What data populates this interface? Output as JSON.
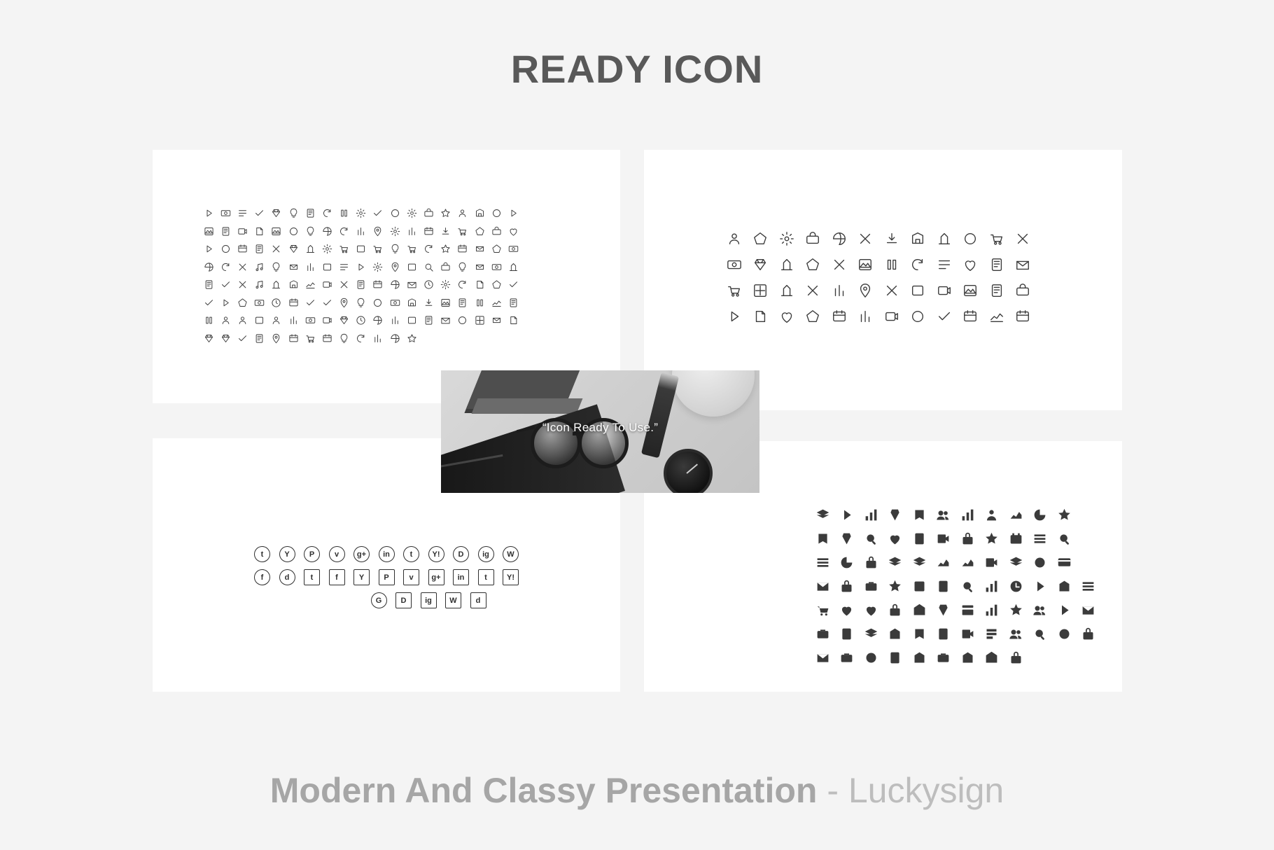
{
  "header": {
    "title": "READY ICON"
  },
  "footer": {
    "bold_text": "Modern And Classy Presentation",
    "light_text": " - Luckysign"
  },
  "photo": {
    "quote": "“Icon Ready To Use.”"
  },
  "panels": {
    "top_left": {
      "name": "outline-icon-set-panel",
      "style": "outline",
      "columns": 19,
      "rows": 8
    },
    "top_right": {
      "name": "outline-icon-set-panel-2",
      "style": "outline",
      "columns": 12,
      "rows": 4
    },
    "bottom_left": {
      "name": "social-media-icon-panel",
      "style": "social"
    },
    "bottom_right": {
      "name": "solid-icon-set-panel",
      "style": "solid",
      "columns": 12,
      "rows": 6
    }
  },
  "colors": {
    "page_background": "#f4f4f4",
    "panel_background": "#ffffff",
    "title_color": "#595959",
    "footer_bold_color": "#a6a6a6",
    "footer_light_color": "#bdbdbd",
    "icon_color": "#3b3b3b"
  },
  "icon_sets": {
    "top_left": [
      "map-pin-icon",
      "mushroom-icon",
      "map-icon",
      "trophy-icon",
      "award-badge-icon",
      "water-drop-icon",
      "fire-icon",
      "cloche-icon",
      "cocktail-glass-icon",
      "bottle-icon",
      "umbrella-icon",
      "phone-icon",
      "thermometer-icon",
      "leaf-icon",
      "droplet-icon",
      "cloud-icon",
      "sun-icon",
      "snowflake-icon",
      "wind-icon",
      "moon-icon",
      "fork-icon",
      "knife-icon",
      "spoon-icon",
      "camera-icon",
      "handheld-console-icon",
      "gamepad-icon",
      "game-device-icon",
      "tablet-icon",
      "smartphone-icon",
      "monitor-icon",
      "clipboard-icon",
      "pencil-icon",
      "pin-icon",
      "image-icon",
      "list-icon",
      "heart-icon",
      "star-icon",
      "menu-icon",
      "crop-icon",
      "layers-icon",
      "mouse-icon",
      "floppy-disk-icon",
      "video-camera-icon",
      "film-strip-icon",
      "radio-icon",
      "tv-icon",
      "calculator-icon",
      "headphones-icon",
      "microphone-icon",
      "record-icon",
      "grid-icon",
      "apps-icon",
      "barcode-icon",
      "qr-icon",
      "checkbox-icon",
      "edit-icon",
      "crop-frame-icon",
      "login-icon",
      "logout-icon",
      "refresh-icon",
      "download-icon",
      "upload-icon",
      "speaker-icon",
      "volume-low-icon",
      "volume-high-icon",
      "volume-mute-icon",
      "play-icon",
      "pause-icon",
      "stop-icon",
      "forward-icon",
      "fullscreen-icon",
      "expand-icon",
      "shrink-icon",
      "arrow-left-icon",
      "arrow-right-icon",
      "arrow-up-icon",
      "arrow-down-icon",
      "export-icon",
      "rewind-icon",
      "triangle-icon",
      "lines-icon",
      "chevrons-left-icon",
      "chevrons-right-icon",
      "shuffle-icon",
      "repeat-icon",
      "music-note-icon",
      "beamed-note-icon",
      "music-icon",
      "plus-box-icon",
      "minus-box-icon",
      "close-box-icon",
      "check-box-icon",
      "layers-stack-icon",
      "plus-icon",
      "minus-icon",
      "close-icon",
      "check-icon",
      "clock-icon",
      "browser-icon",
      "feed-icon",
      "globe-icon",
      "window-icon",
      "bar-chart-icon",
      "archive-icon",
      "suitcase-icon",
      "basket-icon",
      "cart-icon",
      "bag-icon",
      "info-circle-icon",
      "arrow-right-circle-icon",
      "arrow-left-circle-icon",
      "heart-circle-icon",
      "arrow-down-circle-icon",
      "arrow-up-circle-icon",
      "plus-circle-icon",
      "minus-circle-icon",
      "close-circle-icon",
      "check-circle-icon",
      "crop-tool-icon",
      "pen-icon",
      "flag-icon",
      "code-icon",
      "share-icon",
      "printer-icon",
      "shopping-cart-icon",
      "cloud-upload-icon",
      "copy-icon",
      "check-mark-icon",
      "undo-icon",
      "redo-icon",
      "search-icon",
      "zoom-in-icon",
      "eye-icon",
      "cloud-off-icon",
      "back-icon",
      "gift-icon",
      "download-box-icon",
      "id-card-icon",
      "wallet-icon",
      "tag-icon",
      "book-icon",
      "flag-2-icon",
      "cloud-2-icon",
      "umbrella-2-icon",
      "pointer-icon",
      "stroke-icon"
    ],
    "top_right": [
      "cloud-icon",
      "heart-icon",
      "tv-icon",
      "star-icon",
      "sound-off-icon",
      "video-camera-icon",
      "news-icon",
      "envelope-icon",
      "thumbs-up-icon",
      "picture-icon",
      "article-icon",
      "watch-icon",
      "trash-icon",
      "user-icon",
      "key-icon",
      "magnifier-icon",
      "gear-icon",
      "camera-icon",
      "paper-plane-icon",
      "equalizer-icon",
      "money-icon",
      "database-icon",
      "music-note-icon",
      "megaphone-icon",
      "tag-icon",
      "diamond-icon",
      "lock-icon",
      "lightbulb-icon",
      "pencil-icon",
      "monitor-icon",
      "graduation-cap-icon",
      "paint-bucket-icon",
      "food-bowl-icon",
      "t-shirt-icon",
      "fire-icon",
      "bandage-icon",
      "map-pin-icon",
      "eye-icon",
      "speech-bubble-icon",
      "folder-icon",
      "coffee-cup-icon",
      "smartphone-icon",
      "store-icon",
      "calendar-icon",
      "credit-card-icon",
      "mouse-icon",
      "truck-icon",
      "globe-icon"
    ],
    "bottom_right": [
      "target-icon",
      "puzzle-icon",
      "clipboard-icon",
      "paperclip-icon",
      "note-icon",
      "stamp-icon",
      "documents-icon",
      "key-icon",
      "pushpin-icon",
      "binders-icon",
      "flash-icon",
      "blank-icon",
      "bar-chart-icon",
      "bar-chart-up-icon",
      "bar-chart-down-icon",
      "pie-chart-icon",
      "clock-icon",
      "stopwatch-icon",
      "alarm-clock-icon",
      "hourglass-icon",
      "safe-icon",
      "calendar-icon",
      "calendar-clock-icon",
      "blank-icon",
      "presentation-icon",
      "org-chart-icon",
      "team-network-icon",
      "documents-2-icon",
      "id-badge-icon",
      "clipboard-clock-icon",
      "calendar-grid-icon",
      "group-icon",
      "meeting-icon",
      "presenter-icon",
      "hierarchy-icon",
      "blank-icon",
      "time-money-icon",
      "question-coin-icon",
      "dollar-coin-icon",
      "warning-coin-icon",
      "euro-coin-icon",
      "money-bill-icon",
      "wallet-icon",
      "briefcase-icon",
      "ledger-icon",
      "bank-icon",
      "atm-icon",
      "books-icon",
      "safe-box-icon",
      "money-bag-icon",
      "coin-icon",
      "cart-icon",
      "shopping-cart-icon",
      "cart-add-icon",
      "basket-icon",
      "calculator-icon",
      "no-entry-icon",
      "support-icon",
      "credit-card-icon",
      "gift-box-icon",
      "gift-icon",
      "price-tag-icon",
      "purse-icon",
      "balance-icon",
      "package-icon",
      "heart-icon",
      "bird-icon",
      "microphone-icon",
      "globe-icon",
      "newspaper-icon",
      "phone-icon",
      "telephone-icon",
      "chat-icon",
      "screen-icon",
      "envelope-icon",
      "mail-open-icon",
      "mail-stack-icon",
      "tablet-icon",
      "contact-icon",
      "id-icon",
      "card-icon"
    ],
    "social_row_1": [
      "twitter-icon",
      "youtube-icon",
      "pinterest-icon",
      "vimeo-icon",
      "google-plus-icon",
      "linkedin-icon",
      "tumblr-icon",
      "yahoo-icon",
      "dropbox-icon",
      "instagram-icon",
      "wordpress-icon"
    ],
    "social_row_2": [
      "facebook-icon",
      "dribbble-icon",
      "twitter-icon",
      "facebook-icon",
      "youtube-icon",
      "pinterest-icon",
      "vimeo-icon",
      "google-plus-icon",
      "linkedin-icon",
      "tumblr-icon",
      "yahoo-icon"
    ],
    "social_row_3": [
      "globe-icon",
      "dropbox-icon",
      "instagram-icon",
      "wordpress-icon",
      "dribbble-icon"
    ]
  },
  "social_labels": {
    "twitter-icon": "t",
    "youtube-icon": "Y",
    "pinterest-icon": "P",
    "vimeo-icon": "v",
    "google-plus-icon": "g+",
    "linkedin-icon": "in",
    "tumblr-icon": "t",
    "yahoo-icon": "Y!",
    "dropbox-icon": "D",
    "instagram-icon": "ig",
    "wordpress-icon": "W",
    "facebook-icon": "f",
    "dribbble-icon": "d",
    "globe-icon": "G"
  }
}
